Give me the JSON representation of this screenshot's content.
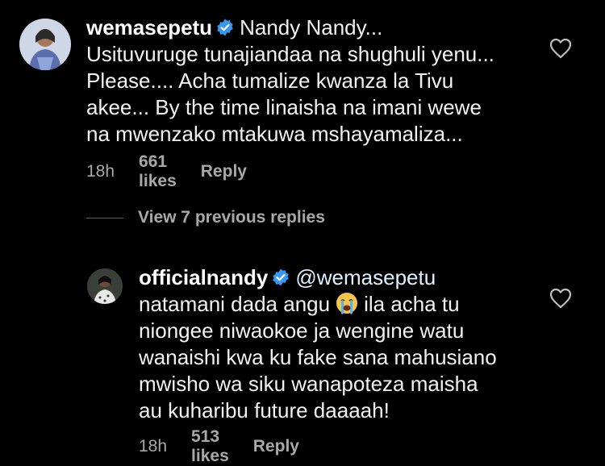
{
  "comments": [
    {
      "username": "wemasepetu",
      "lines": [
        "Nandy Nandy...",
        "Usituvuruge tunajiandaa na shughuli yenu...",
        "Please.... Acha tumalize kwanza la Tivu",
        "akee... By the time linaisha na imani wewe",
        "na mwenzako mtakuwa mshayamaliza..."
      ],
      "time": "18h",
      "likes": "661 likes",
      "reply": "Reply"
    },
    {
      "username": "officialnandy",
      "mention": "@wemasepetu",
      "line2_before": "natamani dada angu",
      "line2_after": "ila acha tu",
      "lines": [
        "niongee niwaokoe ja wengine watu",
        "wanaishi kwa ku fake sana mahusiano",
        "mwisho wa siku wanapoteza maisha",
        "au kuharibu future daaaah!"
      ],
      "time": "18h",
      "likes": "513 likes",
      "reply": "Reply"
    }
  ],
  "view_replies": "View 7 previous replies",
  "icons": {
    "verified": "verified-badge-icon",
    "like": "heart-outline-icon",
    "emoji": "crying-face-emoji"
  },
  "colors": {
    "verified": "#3897f0",
    "background": "#000000",
    "secondary_text": "#a8a8a8"
  }
}
